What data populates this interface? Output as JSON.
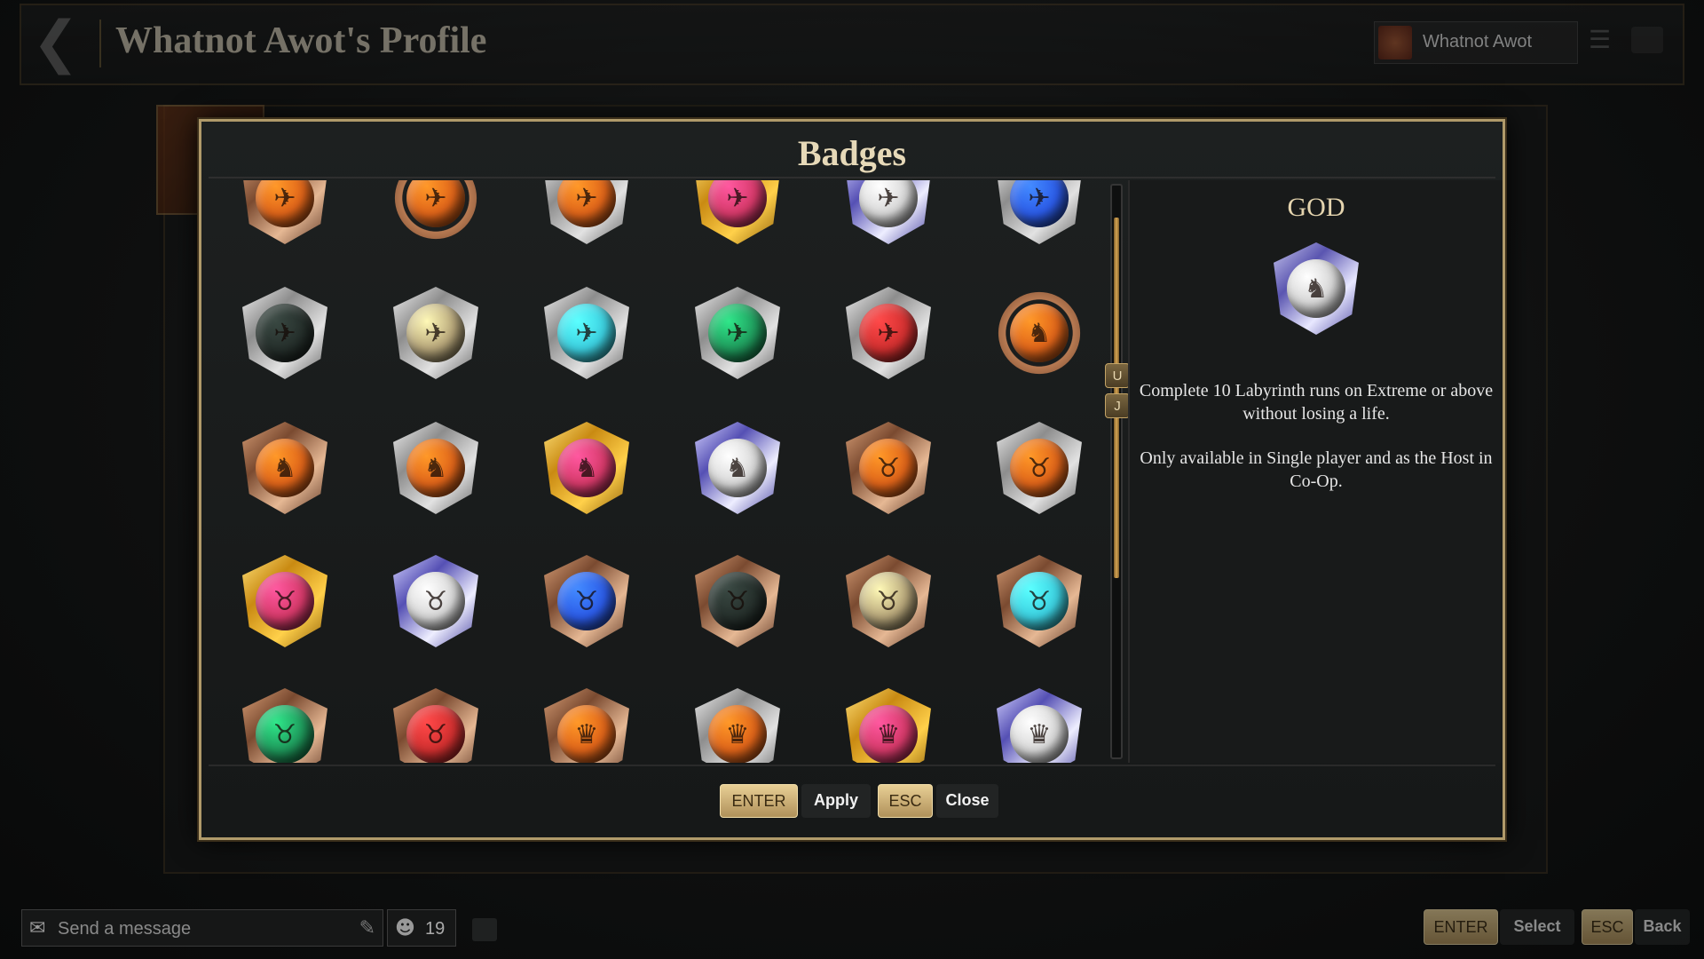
{
  "header": {
    "title": "Whatnot Awot's Profile",
    "profile_name": "Whatnot Awot"
  },
  "modal": {
    "title": "Badges",
    "scroll_up_key": "U",
    "scroll_down_key": "J",
    "selected": {
      "name": "GOD",
      "description": "Complete 10 Labyrinth runs on Extreme or above without losing a life.",
      "note": "Only available in Single player and as the Host in Co-Op."
    },
    "apply_key": "ENTER",
    "apply_label": "Apply",
    "close_key": "ESC",
    "close_label": "Close"
  },
  "badges": [
    {
      "emblem": "wing-icon",
      "gem": "#e0651a",
      "frame": "bronze"
    },
    {
      "emblem": "wing-icon",
      "gem": "#e0651a",
      "frame": "ring"
    },
    {
      "emblem": "wing-icon",
      "gem": "#e0651a",
      "frame": "silver"
    },
    {
      "emblem": "wing-icon",
      "gem": "#d63a6a",
      "frame": "gold"
    },
    {
      "emblem": "wing-icon",
      "gem": "#d8d8d8",
      "frame": "platinum"
    },
    {
      "emblem": "wing-icon",
      "gem": "#2c5ce8",
      "frame": "silver"
    },
    {
      "emblem": "wing-icon",
      "gem": "#26302c",
      "frame": "silver"
    },
    {
      "emblem": "wing-icon",
      "gem": "#b7a67a",
      "frame": "silver"
    },
    {
      "emblem": "wing-icon",
      "gem": "#3cd0e0",
      "frame": "silver"
    },
    {
      "emblem": "wing-icon",
      "gem": "#1f9a5c",
      "frame": "silver"
    },
    {
      "emblem": "wing-icon",
      "gem": "#d23030",
      "frame": "silver"
    },
    {
      "emblem": "strongman-icon",
      "gem": "#e0651a",
      "frame": "ring"
    },
    {
      "emblem": "strongman-icon",
      "gem": "#e0651a",
      "frame": "bronze"
    },
    {
      "emblem": "strongman-icon",
      "gem": "#e0651a",
      "frame": "silver"
    },
    {
      "emblem": "strongman-icon",
      "gem": "#d63a6a",
      "frame": "gold"
    },
    {
      "emblem": "strongman-icon",
      "gem": "#d8d8d8",
      "frame": "platinum"
    },
    {
      "emblem": "bull-icon",
      "gem": "#e0651a",
      "frame": "bronze"
    },
    {
      "emblem": "bull-icon",
      "gem": "#e0651a",
      "frame": "silver"
    },
    {
      "emblem": "bull-icon",
      "gem": "#d63a6a",
      "frame": "gold"
    },
    {
      "emblem": "bull-icon",
      "gem": "#d8d8d8",
      "frame": "platinum"
    },
    {
      "emblem": "bull-icon",
      "gem": "#2c5ce8",
      "frame": "bronze"
    },
    {
      "emblem": "bull-icon",
      "gem": "#26302c",
      "frame": "bronze"
    },
    {
      "emblem": "bull-icon",
      "gem": "#b7a67a",
      "frame": "bronze"
    },
    {
      "emblem": "bull-icon",
      "gem": "#3cd0e0",
      "frame": "bronze"
    },
    {
      "emblem": "bull-icon",
      "gem": "#1f9a5c",
      "frame": "bronze"
    },
    {
      "emblem": "bull-icon",
      "gem": "#d23030",
      "frame": "bronze"
    },
    {
      "emblem": "crown-icon",
      "gem": "#e0651a",
      "frame": "bronze"
    },
    {
      "emblem": "crown-icon",
      "gem": "#e0651a",
      "frame": "silver"
    },
    {
      "emblem": "crown-icon",
      "gem": "#d63a6a",
      "frame": "gold"
    },
    {
      "emblem": "crown-icon",
      "gem": "#d8d8d8",
      "frame": "platinum"
    }
  ],
  "bottom": {
    "chat_placeholder": "Send a message",
    "online_count": "19",
    "hint_enter_key": "ENTER",
    "hint_enter_label": "Select",
    "hint_esc_key": "ESC",
    "hint_esc_label": "Back"
  }
}
